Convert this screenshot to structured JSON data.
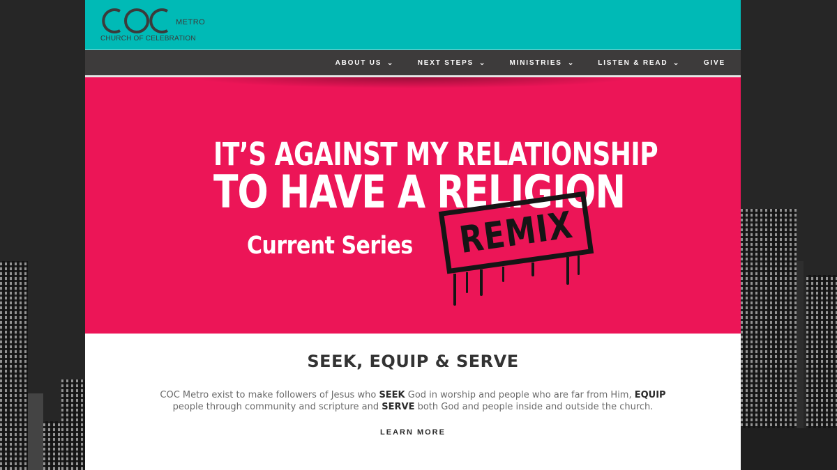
{
  "logo": {
    "mark": "COC",
    "metro": "METRO",
    "subtitle": "CHURCH OF CELEBRATION"
  },
  "nav": {
    "items": [
      {
        "label": "ABOUT US",
        "has_dropdown": true
      },
      {
        "label": "NEXT STEPS",
        "has_dropdown": true
      },
      {
        "label": "MINISTRIES",
        "has_dropdown": true
      },
      {
        "label": "LISTEN & READ",
        "has_dropdown": true
      },
      {
        "label": "GIVE",
        "has_dropdown": false
      }
    ],
    "chevron": "⌄"
  },
  "hero": {
    "line1": "IT’S AGAINST MY RELATIONSHIP",
    "line2": "TO HAVE A RELIGION",
    "current_series": "Current Series",
    "stamp": "REMIX",
    "background_color": "#ec1557"
  },
  "section": {
    "tagline": "SEEK, EQUIP & SERVE",
    "mission_parts": {
      "p1": "COC Metro exist to make followers of Jesus who ",
      "seek": "SEEK",
      "p2": " God in worship and people who are far from Him, ",
      "equip": "EQUIP",
      "p3": " people through community and scripture and ",
      "serve": "SERVE",
      "p4": " both God and people inside and outside the church."
    },
    "learn_more": "LEARN MORE"
  },
  "colors": {
    "topbar": "#00bab6",
    "navbar": "#3d3b3b",
    "hero": "#ec1557"
  }
}
